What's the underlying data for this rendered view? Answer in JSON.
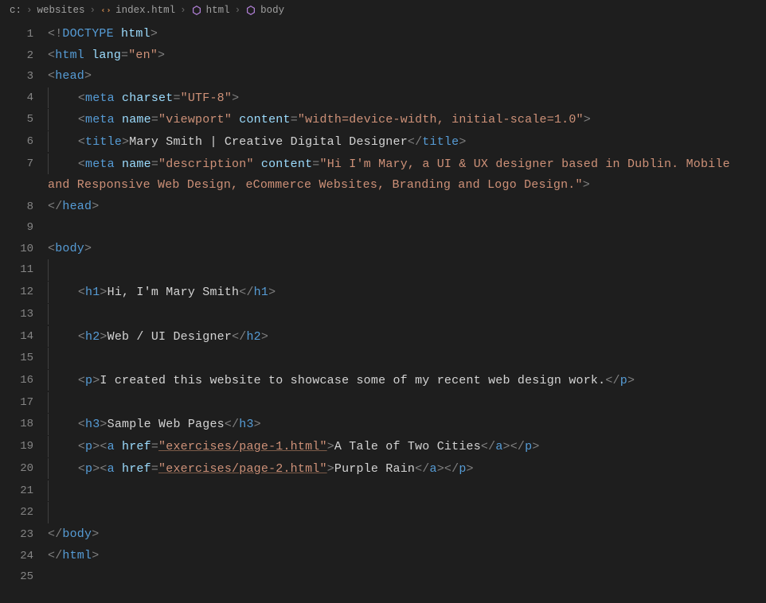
{
  "breadcrumb": {
    "seg1": "c:",
    "seg2": "websites",
    "seg3": "index.html",
    "seg4": "html",
    "seg5": "body"
  },
  "code": {
    "doctype_open": "<!",
    "doctype_kw": "DOCTYPE",
    "doctype_sp": " ",
    "doctype_val": "html",
    "doctype_close": ">",
    "lt": "<",
    "lts": "</",
    "gt": ">",
    "eq": "=",
    "sp": " ",
    "html_tag": "html",
    "lang_attr": "lang",
    "lang_val": "\"en\"",
    "head_tag": "head",
    "meta_tag": "meta",
    "charset_attr": "charset",
    "charset_val": "\"UTF-8\"",
    "name_attr": "name",
    "viewport_val": "\"viewport\"",
    "content_attr": "content",
    "viewport_content_val": "\"width=device-width, initial-scale=1.0\"",
    "title_tag": "title",
    "title_text": "Mary Smith | Creative Digital Designer",
    "description_val": "\"description\"",
    "description_content_val": "\"Hi I'm Mary, a UI & UX designer based in Dublin. Mobile and Responsive Web Design, eCommerce Websites, Branding and Logo Design.\"",
    "body_tag": "body",
    "h1_tag": "h1",
    "h1_text": "Hi, I'm Mary Smith",
    "h2_tag": "h2",
    "h2_text": "Web / UI Designer",
    "p_tag": "p",
    "p1_text": "I created this website to showcase some of my recent web design work.",
    "h3_tag": "h3",
    "h3_text": "Sample Web Pages",
    "a_tag": "a",
    "href_attr": "href",
    "href1_val": "\"exercises/page-1.html\"",
    "a1_text": "A Tale of Two Cities",
    "href2_val": "\"exercises/page-2.html\"",
    "a2_text": "Purple Rain",
    "indent1": "    ",
    "indent_wrap": "        ",
    "guide1": "│   ",
    "line_numbers": [
      "1",
      "2",
      "3",
      "4",
      "5",
      "6",
      "7",
      "8",
      "9",
      "10",
      "11",
      "12",
      "13",
      "14",
      "15",
      "16",
      "17",
      "18",
      "19",
      "20",
      "21",
      "22",
      "23",
      "24",
      "25"
    ]
  }
}
